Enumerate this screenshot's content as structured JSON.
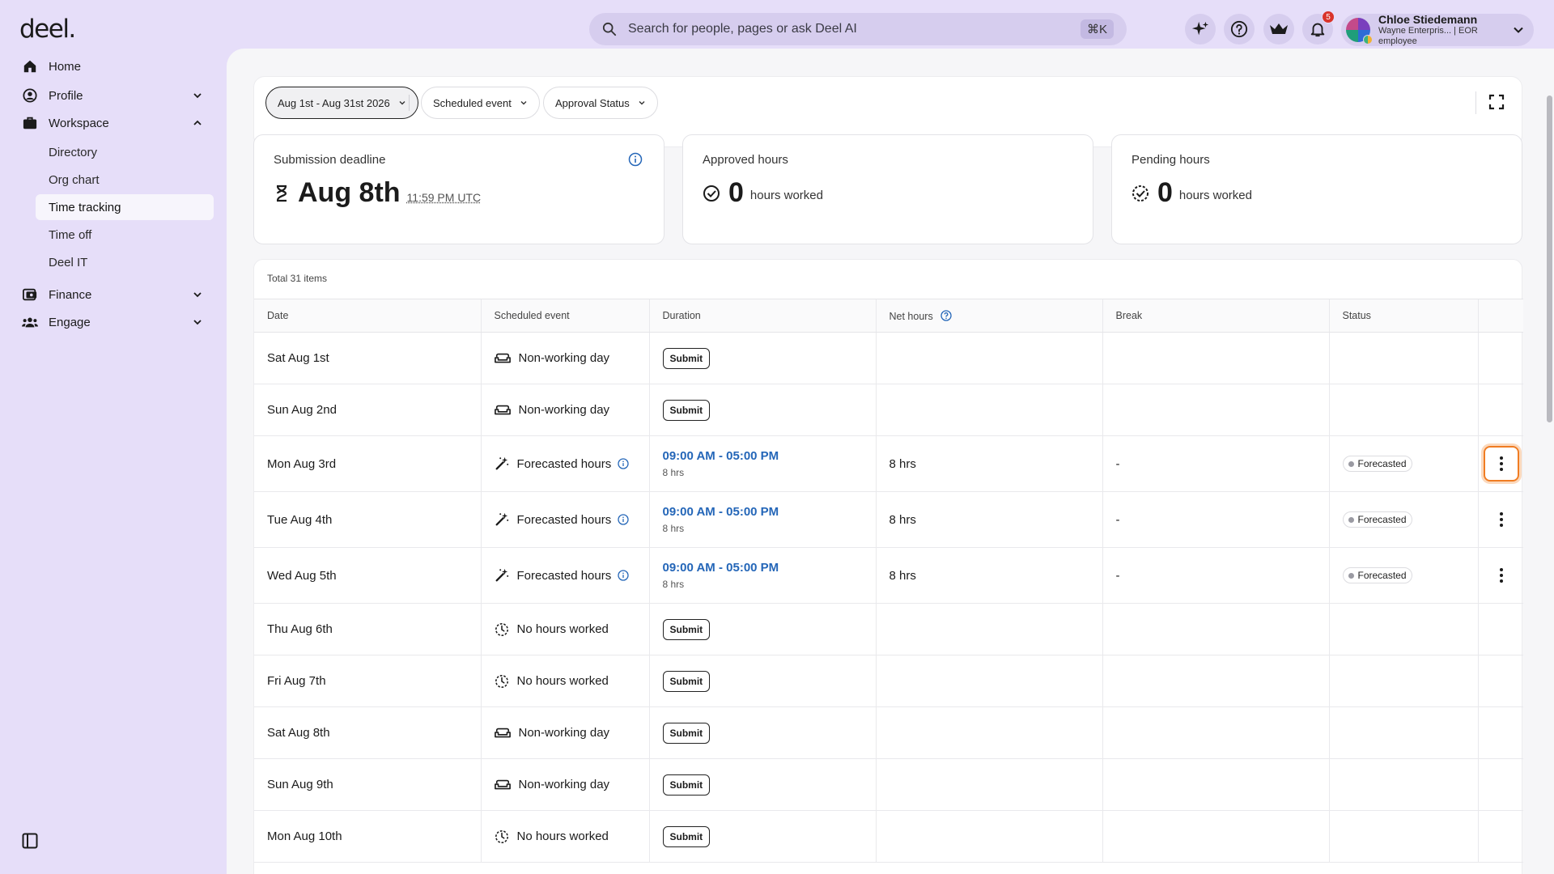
{
  "app": {
    "logo": "deel."
  },
  "topbar": {
    "search_placeholder": "Search for people, pages or ask Deel AI",
    "search_shortcut": "⌘K",
    "notification_count": "5",
    "user_name": "Chloe Stiedemann",
    "user_subtitle": "Wayne Enterpris... | EOR employee"
  },
  "sidebar": {
    "home": "Home",
    "profile": "Profile",
    "workspace": "Workspace",
    "workspace_items": [
      "Directory",
      "Org chart",
      "Time tracking",
      "Time off",
      "Deel IT"
    ],
    "active_item": "Time tracking",
    "finance": "Finance",
    "engage": "Engage"
  },
  "filters": {
    "date_range": "Aug 1st - Aug 31st 2026",
    "scheduled_event": "Scheduled event",
    "approval_status": "Approval Status"
  },
  "cards": {
    "deadline_title": "Submission deadline",
    "deadline_date": "Aug 8th",
    "deadline_time": "11:59 PM UTC",
    "approved_title": "Approved hours",
    "approved_value": "0",
    "approved_unit": "hours worked",
    "pending_title": "Pending hours",
    "pending_value": "0",
    "pending_unit": "hours worked"
  },
  "table": {
    "total_label": "Total 31 items",
    "columns": [
      "Date",
      "Scheduled event",
      "Duration",
      "Net hours",
      "Break",
      "Status"
    ],
    "rows": [
      {
        "date": "Sat Aug 1st",
        "event": "Non-working day",
        "event_icon": "sofa-icon",
        "submit": "Submit"
      },
      {
        "date": "Sun Aug 2nd",
        "event": "Non-working day",
        "event_icon": "sofa-icon",
        "submit": "Submit"
      },
      {
        "date": "Mon Aug 3rd",
        "event": "Forecasted hours",
        "event_icon": "magic-wand-icon",
        "duration": "09:00 AM - 05:00 PM",
        "duration_sub": "8 hrs",
        "net": "8 hrs",
        "break": "-",
        "status": "Forecasted"
      },
      {
        "date": "Tue Aug 4th",
        "event": "Forecasted hours",
        "event_icon": "magic-wand-icon",
        "duration": "09:00 AM - 05:00 PM",
        "duration_sub": "8 hrs",
        "net": "8 hrs",
        "break": "-",
        "status": "Forecasted"
      },
      {
        "date": "Wed Aug 5th",
        "event": "Forecasted hours",
        "event_icon": "magic-wand-icon",
        "duration": "09:00 AM - 05:00 PM",
        "duration_sub": "8 hrs",
        "net": "8 hrs",
        "break": "-",
        "status": "Forecasted"
      },
      {
        "date": "Thu Aug 6th",
        "event": "No hours worked",
        "event_icon": "dashed-clock-icon",
        "submit": "Submit"
      },
      {
        "date": "Fri Aug 7th",
        "event": "No hours worked",
        "event_icon": "dashed-clock-icon",
        "submit": "Submit"
      },
      {
        "date": "Sat Aug 8th",
        "event": "Non-working day",
        "event_icon": "sofa-icon",
        "submit": "Submit"
      },
      {
        "date": "Sun Aug 9th",
        "event": "Non-working day",
        "event_icon": "sofa-icon",
        "submit": "Submit"
      },
      {
        "date": "Mon Aug 10th",
        "event": "No hours worked",
        "event_icon": "dashed-clock-icon",
        "submit": "Submit"
      }
    ]
  },
  "colors": {
    "accent_blue": "#2466b8",
    "focus_orange": "#f07c22",
    "background_lavender": "#e6def9"
  }
}
